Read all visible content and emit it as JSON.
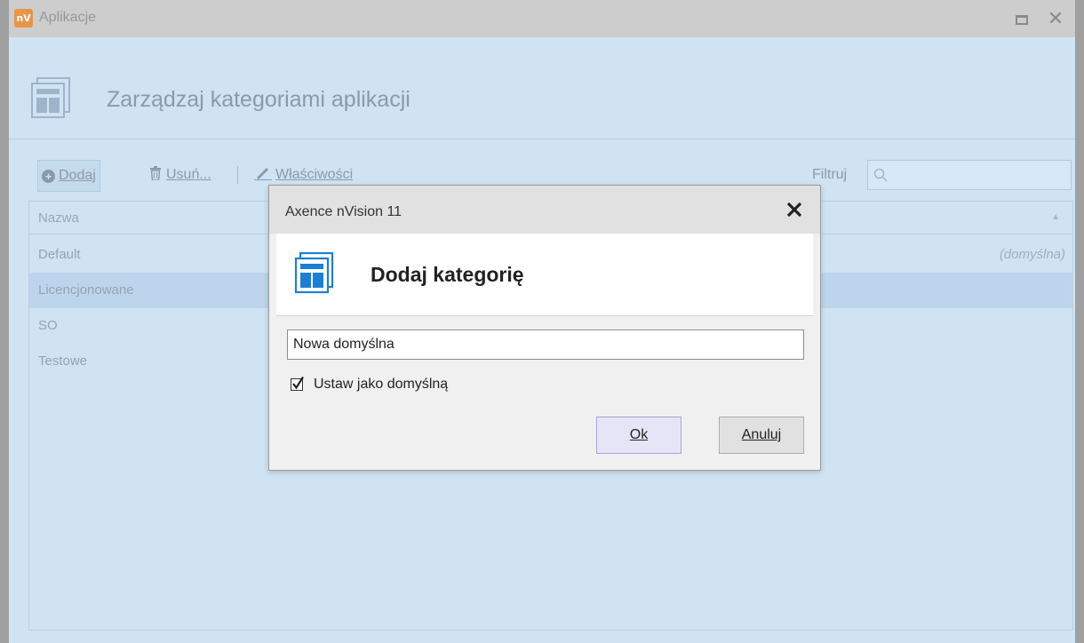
{
  "window": {
    "title": "Aplikacje",
    "logo_text": "nV",
    "header_title": "Zarządzaj kategoriami aplikacji"
  },
  "toolbar": {
    "add": "Dodaj",
    "delete": "Usuń...",
    "properties": "Właściwości",
    "filter_label": "Filtruj",
    "filter_value": ""
  },
  "list": {
    "column_name": "Nazwa",
    "rows": [
      {
        "name": "Default",
        "tag": "(domyślna)",
        "selected": false
      },
      {
        "name": "Licencjonowane",
        "tag": "",
        "selected": true
      },
      {
        "name": "SO",
        "tag": "",
        "selected": false
      },
      {
        "name": "Testowe",
        "tag": "",
        "selected": false
      }
    ]
  },
  "dialog": {
    "title": "Axence nVision 11",
    "heading": "Dodaj kategorię",
    "name_value": "Nowa domyślna",
    "set_default_label": "Ustaw jako domyślną",
    "set_default_checked": true,
    "ok": "Ok",
    "cancel": "Anuluj"
  },
  "colors": {
    "window_bg": "#cfe3f3",
    "titlebar": "#cdcdcd",
    "selected_row": "#bdd5ec",
    "dialog_bg": "#f0f0f0",
    "ok_button": "#e5e5f7",
    "icon_blue": "#1c7fd6",
    "logo_orange": "#e8954a"
  },
  "icons": {
    "app_logo": "nvision-logo-icon",
    "header": "category-window-icon",
    "add": "plus-circle-icon",
    "delete": "trash-icon",
    "properties": "pencil-icon",
    "filter": "search-icon",
    "dialog_close": "close-icon",
    "checkbox": "checkbox-checked-icon"
  }
}
